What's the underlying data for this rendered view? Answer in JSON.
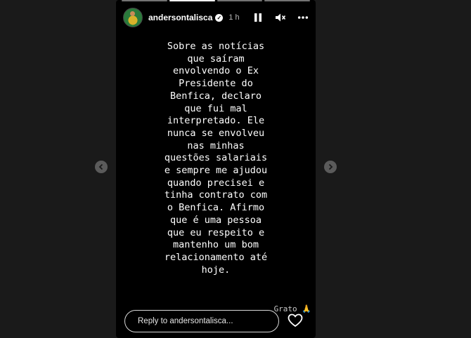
{
  "header": {
    "username": "andersontalisca",
    "time": "1 h"
  },
  "icons": {
    "pause": "pause-icon",
    "mute": "muted-speaker-icon",
    "more": "more-options-icon",
    "verified": "verified-badge-icon",
    "prev": "chevron-left-icon",
    "next": "chevron-right-icon",
    "like": "heart-icon"
  },
  "caption": {
    "lines": [
      "Sobre as notícias",
      "que saíram",
      "envolvendo o Ex",
      "Presidente do",
      "Benfica, declaro",
      "que fui mal",
      "interpretado. Ele",
      "nunca se envolveu",
      "nas minhas",
      "questões salariais",
      "e sempre me ajudou",
      "quando precisei e",
      "tinha contrato com",
      "o Benfica. Afirmo",
      "que é uma pessoa",
      "que eu respeito e",
      "mantenho um bom",
      "relacionamento até",
      "hoje."
    ],
    "signoff": "Grato 🙏"
  },
  "reply": {
    "placeholder": "Reply to andersontalisca..."
  },
  "progress": {
    "segments": 4,
    "active": 1
  }
}
